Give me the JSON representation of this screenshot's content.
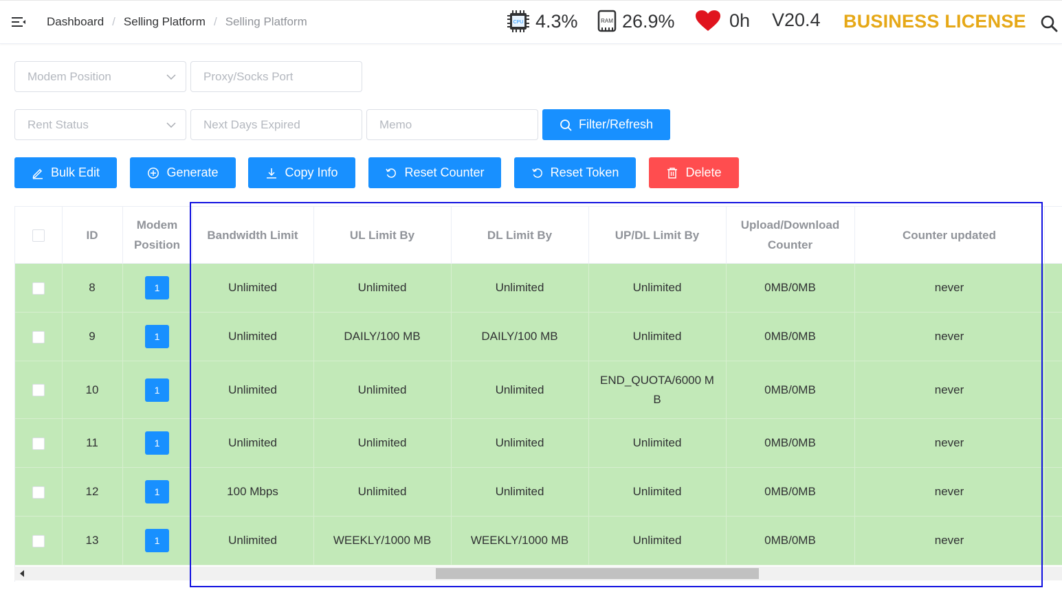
{
  "header": {
    "breadcrumb": [
      "Dashboard",
      "Selling Platform",
      "Selling Platform"
    ],
    "cpu_icon_label": "CPU",
    "cpu": "4.3%",
    "ram_icon_label": "RAM",
    "ram": "26.9%",
    "uptime": "0h",
    "version": "V20.4",
    "license": "BUSINESS LICENSE",
    "icons": [
      "menu-icon",
      "cpu-icon",
      "ram-icon",
      "heart-icon",
      "search-icon"
    ],
    "colors": {
      "license": "#e6a817",
      "heart": "#e0141e"
    }
  },
  "filters": {
    "modem_position": {
      "placeholder": "Modem Position"
    },
    "proxy_port": {
      "placeholder": "Proxy/Socks Port"
    },
    "rent_status": {
      "placeholder": "Rent Status"
    },
    "next_days_expired": {
      "placeholder": "Next Days Expired"
    },
    "memo": {
      "placeholder": "Memo"
    },
    "filter_button": "Filter/Refresh"
  },
  "actions": {
    "bulk_edit": "Bulk Edit",
    "generate": "Generate",
    "copy_info": "Copy Info",
    "reset_counter": "Reset Counter",
    "reset_token": "Reset Token",
    "delete": "Delete",
    "colors": {
      "primary": "#1890ff",
      "danger": "#ff4d4f"
    }
  },
  "table": {
    "columns": {
      "id": "ID",
      "modem_position_1": "Modem",
      "modem_position_2": "Position",
      "bandwidth": "Bandwidth Limit",
      "ul": "UL Limit By",
      "dl": "DL Limit By",
      "updl": "UP/DL Limit By",
      "counter_1": "Upload/Download",
      "counter_2": "Counter",
      "updated": "Counter updated"
    },
    "row_color": "#c2e9b8",
    "rows": [
      {
        "id": "8",
        "pos": "1",
        "bw": "Unlimited",
        "ul": "Unlimited",
        "dl": "Unlimited",
        "updl": "Unlimited",
        "counter": "0MB/0MB",
        "updated": "never"
      },
      {
        "id": "9",
        "pos": "1",
        "bw": "Unlimited",
        "ul": "DAILY/100 MB",
        "dl": "DAILY/100 MB",
        "updl": "Unlimited",
        "counter": "0MB/0MB",
        "updated": "never"
      },
      {
        "id": "10",
        "pos": "1",
        "bw": "Unlimited",
        "ul": "Unlimited",
        "dl": "Unlimited",
        "updl": "END_QUOTA/6000 MB",
        "counter": "0MB/0MB",
        "updated": "never"
      },
      {
        "id": "11",
        "pos": "1",
        "bw": "Unlimited",
        "ul": "Unlimited",
        "dl": "Unlimited",
        "updl": "Unlimited",
        "counter": "0MB/0MB",
        "updated": "never"
      },
      {
        "id": "12",
        "pos": "1",
        "bw": "100 Mbps",
        "ul": "Unlimited",
        "dl": "Unlimited",
        "updl": "Unlimited",
        "counter": "0MB/0MB",
        "updated": "never"
      },
      {
        "id": "13",
        "pos": "1",
        "bw": "Unlimited",
        "ul": "WEEKLY/1000 MB",
        "dl": "WEEKLY/1000 MB",
        "updl": "Unlimited",
        "counter": "0MB/0MB",
        "updated": "never"
      }
    ]
  }
}
